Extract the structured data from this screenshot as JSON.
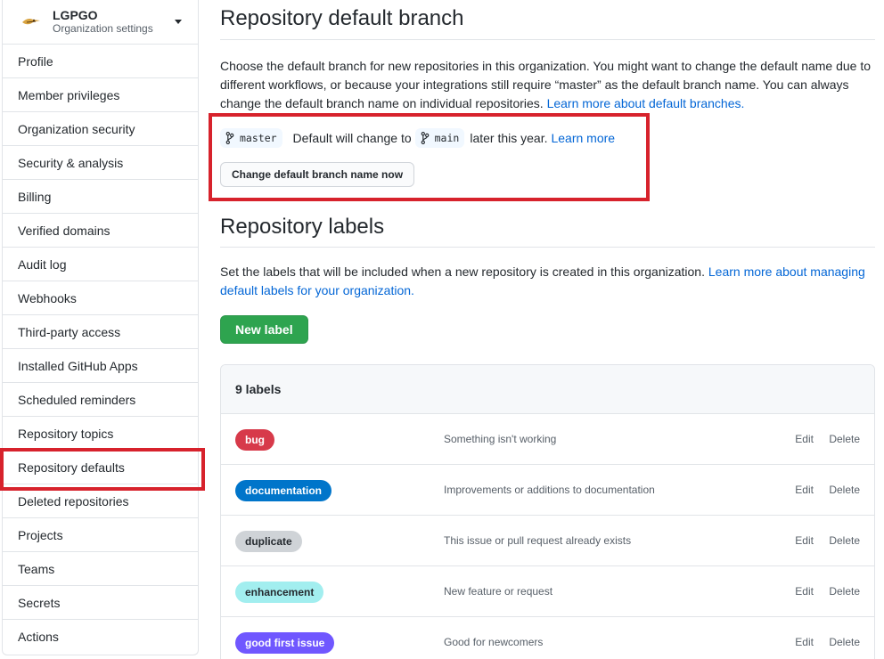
{
  "org": {
    "name": "LGPGO",
    "subtitle": "Organization settings"
  },
  "sidebar": {
    "items": [
      {
        "label": "Profile"
      },
      {
        "label": "Member privileges"
      },
      {
        "label": "Organization security"
      },
      {
        "label": "Security & analysis"
      },
      {
        "label": "Billing"
      },
      {
        "label": "Verified domains"
      },
      {
        "label": "Audit log"
      },
      {
        "label": "Webhooks"
      },
      {
        "label": "Third-party access"
      },
      {
        "label": "Installed GitHub Apps"
      },
      {
        "label": "Scheduled reminders"
      },
      {
        "label": "Repository topics"
      },
      {
        "label": "Repository defaults"
      },
      {
        "label": "Deleted repositories"
      },
      {
        "label": "Projects"
      },
      {
        "label": "Teams"
      },
      {
        "label": "Secrets"
      },
      {
        "label": "Actions"
      }
    ]
  },
  "default_branch": {
    "title": "Repository default branch",
    "description": "Choose the default branch for new repositories in this organization. You might want to change the default name due to different workflows, or because your integrations still require “master” as the default branch name. You can always change the default branch name on individual repositories.",
    "learn_link": "Learn more about default branches.",
    "current_branch": "master",
    "change_text": "Default will change to",
    "new_branch": "main",
    "later_text": "later this year.",
    "learn_more": "Learn more",
    "change_button": "Change default branch name now"
  },
  "repo_labels": {
    "title": "Repository labels",
    "description": "Set the labels that will be included when a new repository is created in this organization.",
    "learn_link": "Learn more about managing default labels for your organization.",
    "new_label_button": "New label",
    "count": "9 labels",
    "edit": "Edit",
    "delete": "Delete",
    "items": [
      {
        "name": "bug",
        "desc": "Something isn't working",
        "bg": "#d73a4a",
        "fg": "#ffffff"
      },
      {
        "name": "documentation",
        "desc": "Improvements or additions to documentation",
        "bg": "#0075ca",
        "fg": "#ffffff"
      },
      {
        "name": "duplicate",
        "desc": "This issue or pull request already exists",
        "bg": "#cfd3d7",
        "fg": "#24292e"
      },
      {
        "name": "enhancement",
        "desc": "New feature or request",
        "bg": "#a2eeef",
        "fg": "#24292e"
      },
      {
        "name": "good first issue",
        "desc": "Good for newcomers",
        "bg": "#7057ff",
        "fg": "#ffffff"
      }
    ]
  },
  "colors": {
    "accent": "#0366d6",
    "highlight": "#d7222c",
    "primary_button": "#2ea44f"
  }
}
